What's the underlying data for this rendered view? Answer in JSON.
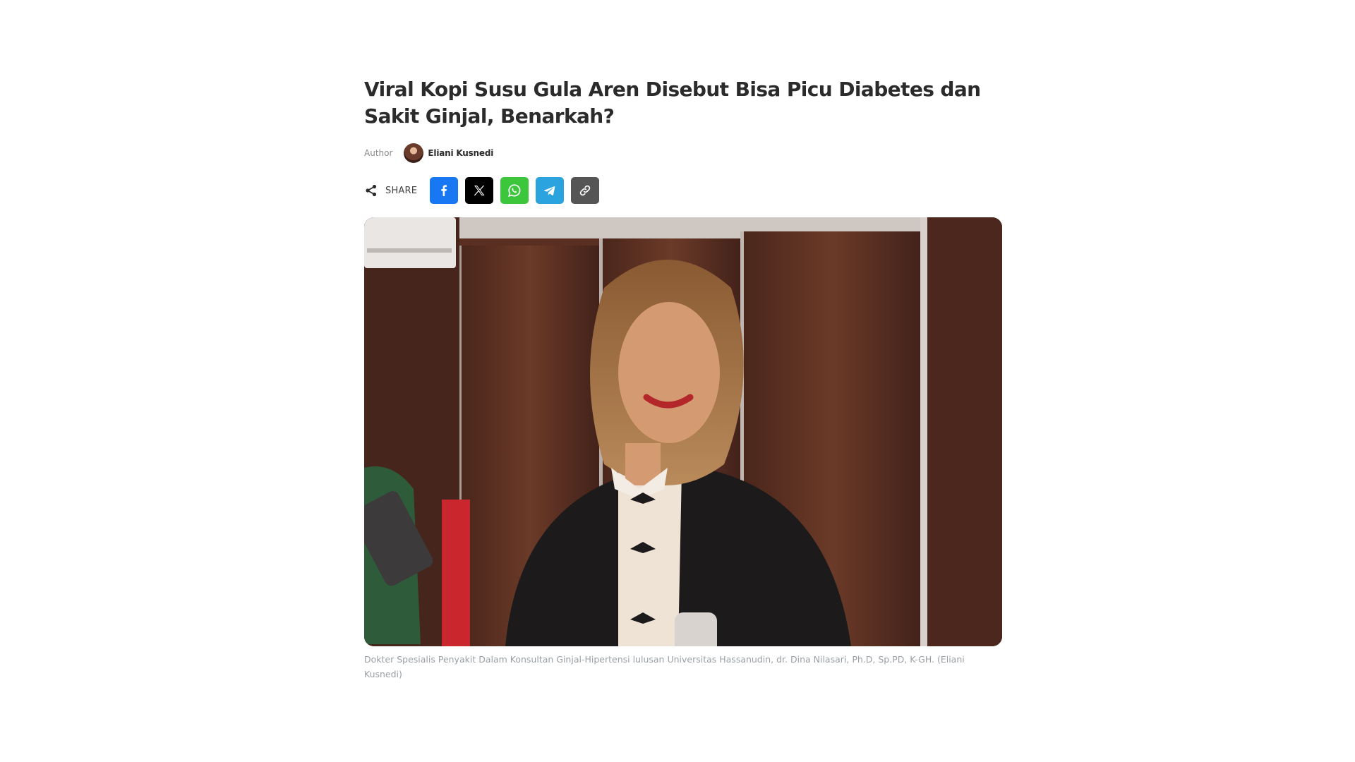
{
  "article": {
    "title": "Viral Kopi Susu Gula Aren Disebut Bisa Picu Diabetes dan Sakit Ginjal, Benarkah?",
    "author_label": "Author",
    "author_name": "Eliani Kusnedi",
    "share_label": "SHARE",
    "share_buttons": [
      {
        "name": "facebook",
        "icon": "facebook-icon",
        "color": "#1877f2"
      },
      {
        "name": "x",
        "icon": "x-icon",
        "color": "#000000"
      },
      {
        "name": "whatsapp",
        "icon": "whatsapp-icon",
        "color": "#25d366"
      },
      {
        "name": "telegram",
        "icon": "telegram-icon",
        "color": "#2aa3df"
      },
      {
        "name": "copy-link",
        "icon": "link-icon",
        "color": "#555555"
      }
    ],
    "caption": "Dokter Spesialis Penyakit Dalam Konsultan Ginjal-Hipertensi lulusan Universitas Hassanudin, dr. Dina Nilasari, Ph.D, Sp.PD, K-GH. (Eliani Kusnedi)"
  }
}
